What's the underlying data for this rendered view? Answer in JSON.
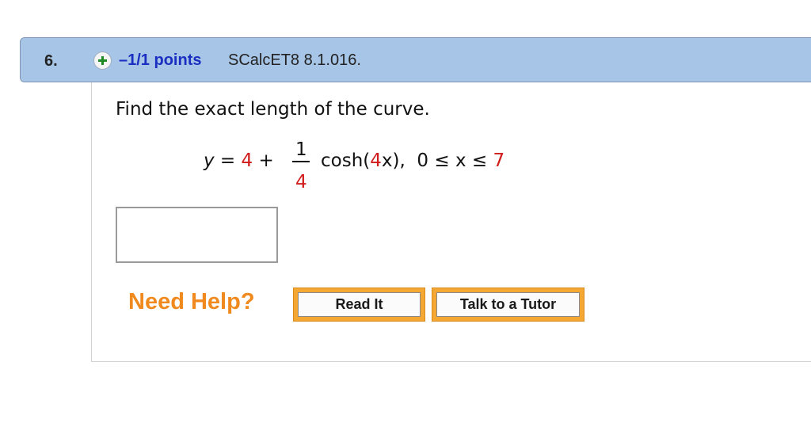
{
  "question": {
    "number": "6.",
    "points": "–1/1 points",
    "code": "SCalcET8 8.1.016."
  },
  "prompt": "Find the exact length of the curve.",
  "equation": {
    "y_part": "y = ",
    "const": "4",
    "plus": " + ",
    "frac_num": "1",
    "frac_den": "4",
    "cosh_open": "cosh(",
    "coef": "4",
    "cosh_close": "x),  0 ≤ x ≤ ",
    "upper": "7"
  },
  "answer": {
    "value": ""
  },
  "help": {
    "label": "Need Help?",
    "read_it": "Read It",
    "tutor": "Talk to a Tutor"
  },
  "colors": {
    "header_bg": "#a7c5e6",
    "points_blue": "#1a2fc2",
    "highlight_red": "#d11c1c",
    "help_orange": "#f08a1f",
    "button_orange": "#f5a733"
  },
  "icons": {
    "add": "plus-circle-icon"
  }
}
